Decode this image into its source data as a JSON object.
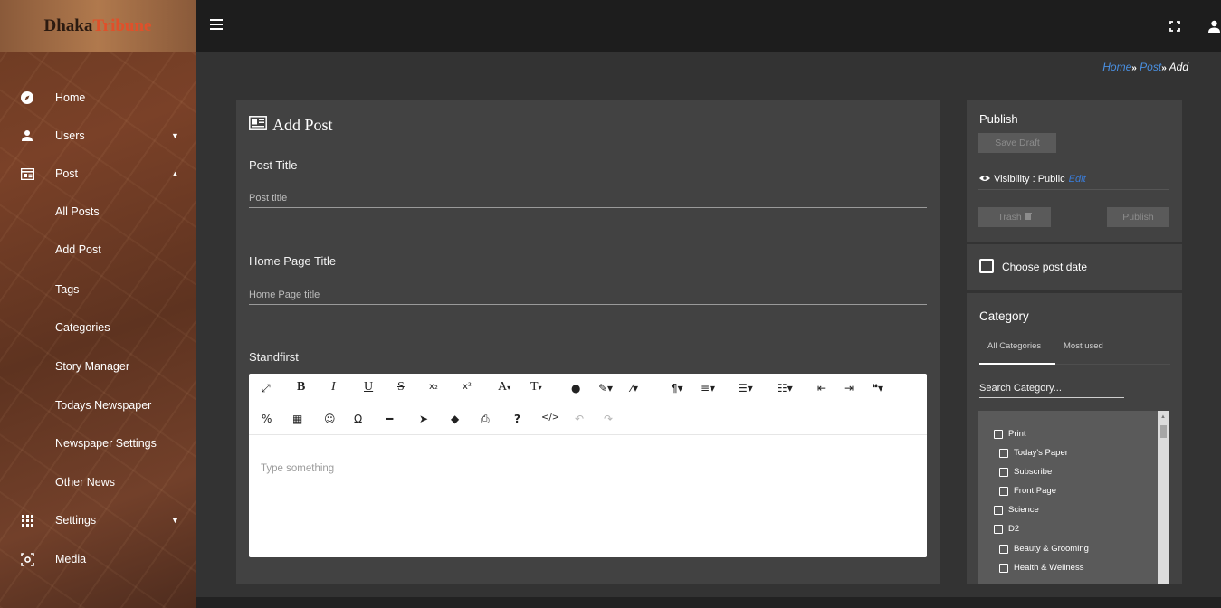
{
  "brand": {
    "part1": "Dhaka",
    "part2": "Tribune"
  },
  "sidebar": {
    "items": [
      {
        "label": "Home",
        "icon": "compass-icon"
      },
      {
        "label": "Users",
        "icon": "person-icon",
        "caret": "▼"
      },
      {
        "label": "Post",
        "icon": "newspaper-icon",
        "caret": "▲"
      },
      {
        "label": "All Posts"
      },
      {
        "label": "Add Post"
      },
      {
        "label": "Tags"
      },
      {
        "label": "Categories"
      },
      {
        "label": "Story Manager"
      },
      {
        "label": "Todays Newspaper"
      },
      {
        "label": "Newspaper Settings"
      },
      {
        "label": "Other News"
      },
      {
        "label": "Settings",
        "icon": "grid-icon",
        "caret": "▼"
      },
      {
        "label": "Media",
        "icon": "camera-scan-icon"
      }
    ]
  },
  "breadcrumb": {
    "home": "Home",
    "post": "Post",
    "current": "Add",
    "sep": "»"
  },
  "main": {
    "title": "Add Post",
    "post_title_label": "Post Title",
    "post_title_placeholder": "Post title",
    "home_title_label": "Home Page Title",
    "home_title_placeholder": "Home Page title",
    "standfirst_label": "Standfirst",
    "editor_placeholder": "Type something"
  },
  "toolbar": {
    "bold": "B",
    "italic": "I",
    "underline": "U",
    "strike": "S",
    "subscript": "x₂",
    "superscript": "x²",
    "font_size": "A",
    "font_family": "T",
    "drop": "▾"
  },
  "publish": {
    "title": "Publish",
    "save_draft": "Save Draft",
    "visibility_label": "Visibility : Public",
    "edit": "Edit",
    "trash": "Trash",
    "publish_btn": "Publish"
  },
  "date": {
    "label": "Choose post date"
  },
  "category": {
    "title": "Category",
    "tab_all": "All Categories",
    "tab_used": "Most used",
    "search_placeholder": "Search Category...",
    "items": [
      {
        "label": "Print"
      },
      {
        "label": "Today's Paper"
      },
      {
        "label": "Subscribe"
      },
      {
        "label": "Front Page"
      },
      {
        "label": "Science"
      },
      {
        "label": "D2"
      },
      {
        "label": "Beauty & Grooming"
      },
      {
        "label": "Health & Wellness"
      }
    ]
  },
  "colors": {
    "accent": "#4a90e2",
    "panel": "#424242",
    "topbar": "#1d1d1d"
  }
}
